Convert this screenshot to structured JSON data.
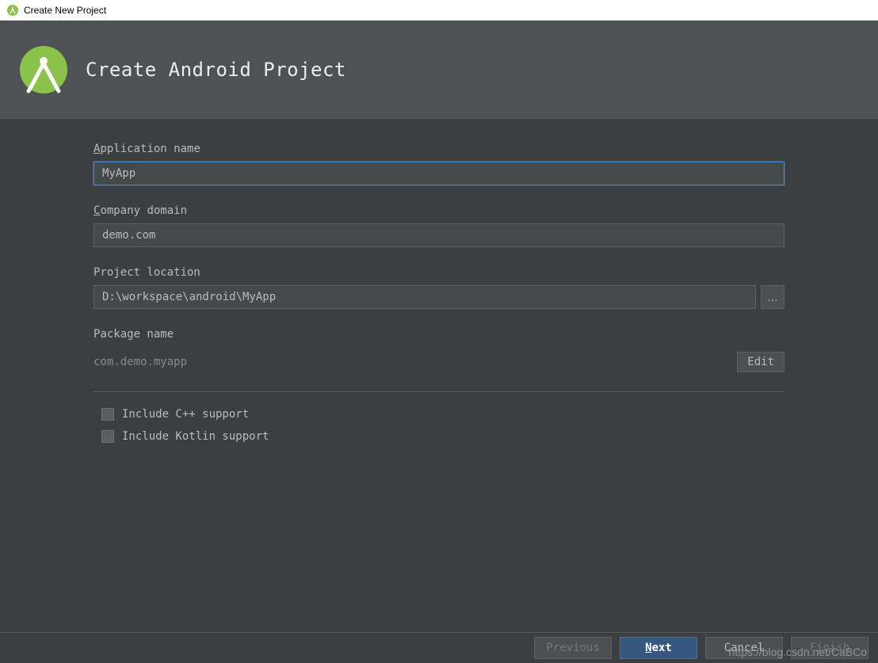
{
  "titlebar": {
    "title": "Create New Project"
  },
  "header": {
    "title": "Create Android Project"
  },
  "fields": {
    "app_name": {
      "label_prefix": "A",
      "label_rest": "pplication name",
      "value": "MyApp"
    },
    "company_domain": {
      "label_prefix": "C",
      "label_rest": "ompany domain",
      "value": "demo.com"
    },
    "project_location": {
      "label": "Project location",
      "value": "D:\\workspace\\android\\MyApp",
      "browse_label": "…"
    },
    "package_name": {
      "label": "Package name",
      "value": "com.demo.myapp",
      "edit_label": "Edit"
    }
  },
  "checkboxes": {
    "cpp": "Include C++ support",
    "kotlin": "Include Kotlin support"
  },
  "footer": {
    "previous": "Previous",
    "next_prefix": "N",
    "next_rest": "ext",
    "cancel": "Cancel",
    "finish": "Finish"
  },
  "watermark": "https://blog.csdn.net/CaBCo"
}
